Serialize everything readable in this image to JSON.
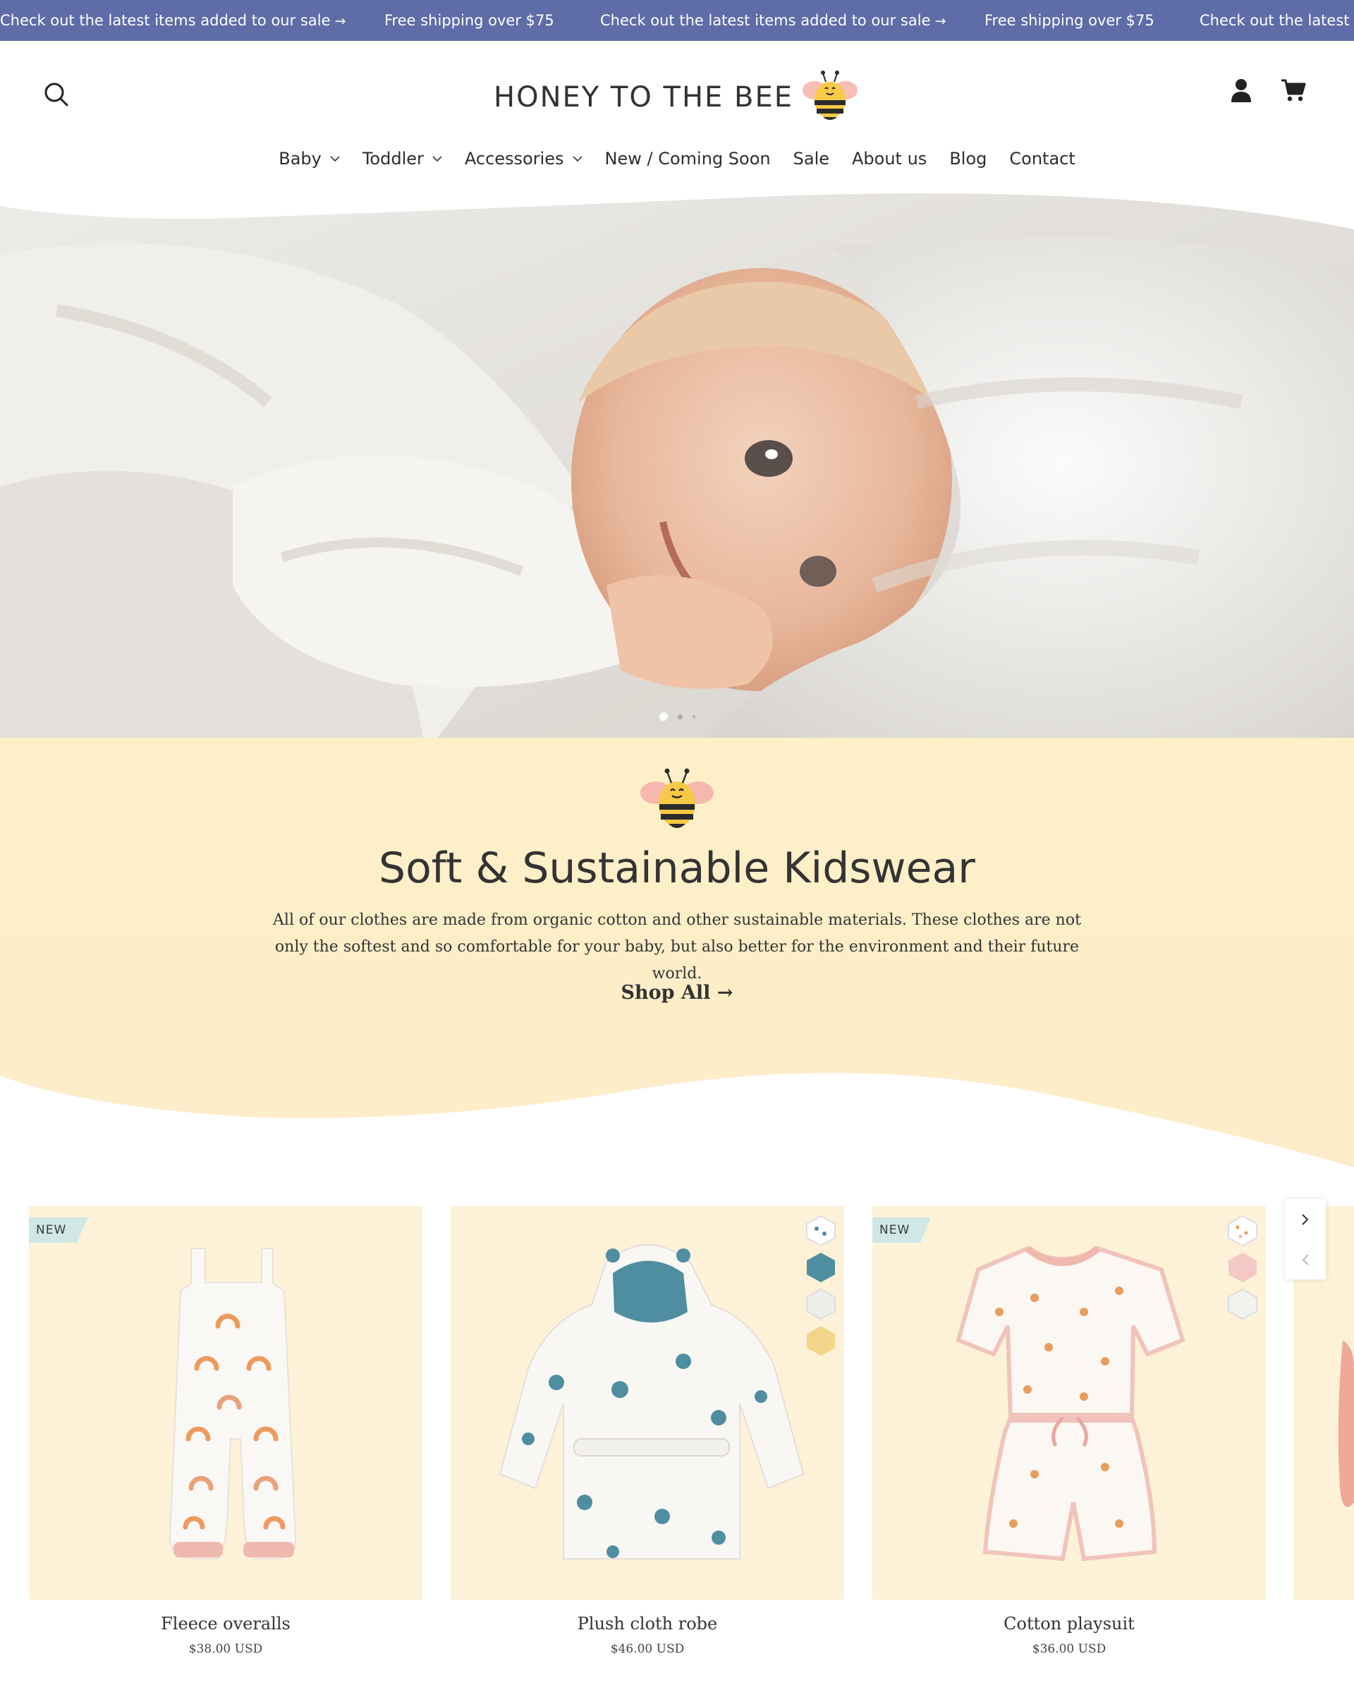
{
  "announcement": {
    "items": [
      {
        "text": "Check out the latest items added to our sale",
        "arrow": "→"
      },
      {
        "text": "Free shipping over $75",
        "arrow": ""
      },
      {
        "text": "Check out the latest items added to our sale",
        "arrow": "→"
      },
      {
        "text": "Free shipping over $75",
        "arrow": ""
      },
      {
        "text": "Check out the latest it",
        "arrow": ""
      }
    ]
  },
  "header": {
    "logo_text": "HONEY TO THE BEE",
    "icons": [
      "search-icon",
      "account-icon",
      "cart-icon"
    ]
  },
  "nav": {
    "items": [
      {
        "label": "Baby",
        "dropdown": true
      },
      {
        "label": "Toddler",
        "dropdown": true
      },
      {
        "label": "Accessories",
        "dropdown": true
      },
      {
        "label": "New / Coming Soon",
        "dropdown": false
      },
      {
        "label": "Sale",
        "dropdown": false
      },
      {
        "label": "About us",
        "dropdown": false
      },
      {
        "label": "Blog",
        "dropdown": false
      },
      {
        "label": "Contact",
        "dropdown": false
      }
    ]
  },
  "hero": {
    "slide_count": 3,
    "active_slide": 1
  },
  "promo": {
    "title": "Soft & Sustainable Kidswear",
    "body": "All of our clothes are made from organic cotton and other sustainable materials. These clothes are not only the softest and so comfortable for your baby, but also better for the environment and their future world.",
    "cta": "Shop All →"
  },
  "products": [
    {
      "name": "Fleece overalls",
      "price": "$38.00 USD",
      "badge": "NEW",
      "swatches": []
    },
    {
      "name": "Plush cloth robe",
      "price": "$46.00 USD",
      "badge": "",
      "swatches": [
        "#ffffff",
        "#4f8ea0",
        "#eeeeea",
        "#f3d58a"
      ]
    },
    {
      "name": "Cotton playsuit",
      "price": "$36.00 USD",
      "badge": "NEW",
      "swatches": [
        "#ffffff",
        "#f3c9c6",
        "#f2f2ee"
      ]
    }
  ],
  "colors": {
    "announcement_bg": "#5e6ca7",
    "promo_bg": "#fdf0c9",
    "product_bg": "#fdf2d8",
    "badge_bg": "#cfe8e5"
  }
}
